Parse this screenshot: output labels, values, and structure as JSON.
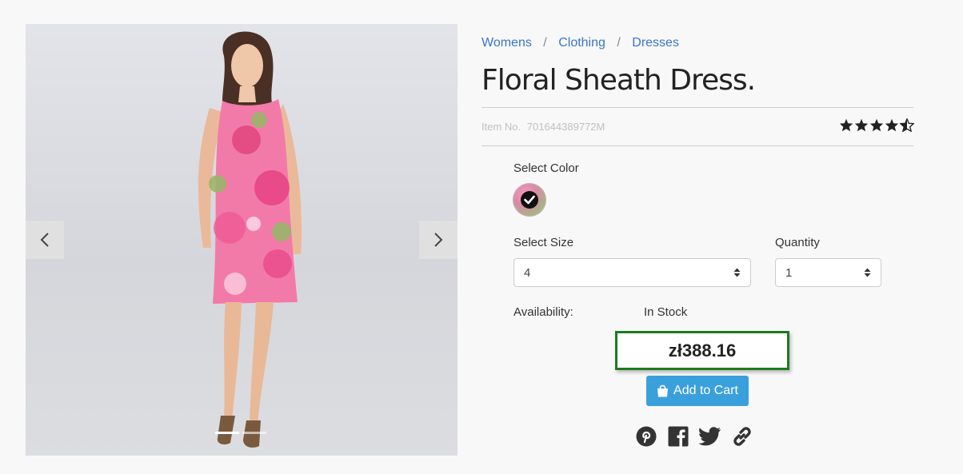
{
  "breadcrumb": {
    "items": [
      "Womens",
      "Clothing",
      "Dresses"
    ],
    "separator": "/"
  },
  "product": {
    "title": "Floral Sheath Dress.",
    "item_label": "Item No.",
    "item_number": "701644389772M",
    "rating": 4.5,
    "rating_max": 5
  },
  "color": {
    "label": "Select Color",
    "selected_swatch": "pink-floral"
  },
  "size": {
    "label": "Select Size",
    "value": "4"
  },
  "quantity": {
    "label": "Quantity",
    "value": "1"
  },
  "availability": {
    "label": "Availability:",
    "value": "In Stock"
  },
  "price": "zł388.16",
  "cart_button": {
    "label": "Add to Cart",
    "icon": "shopping-bag-icon"
  },
  "gallery": {
    "slide_count": 2,
    "active_slide": 1
  },
  "social": [
    "pinterest-icon",
    "facebook-icon",
    "twitter-icon",
    "link-icon"
  ],
  "colors": {
    "link": "#3a75c4",
    "cart_button": "#3aa0dc",
    "price_border": "#1f7a1f",
    "star": "#222222"
  }
}
